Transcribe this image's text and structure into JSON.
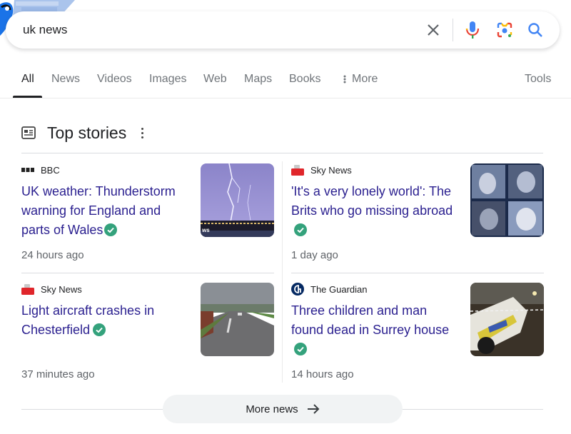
{
  "search": {
    "query": "uk news",
    "icons": [
      "clear-icon",
      "voice-search-icon",
      "lens-icon",
      "search-icon"
    ]
  },
  "tabs": [
    {
      "label": "All",
      "active": true
    },
    {
      "label": "News"
    },
    {
      "label": "Videos"
    },
    {
      "label": "Images"
    },
    {
      "label": "Web"
    },
    {
      "label": "Maps"
    },
    {
      "label": "Books"
    },
    {
      "label": "More",
      "icon": "kebab-icon"
    }
  ],
  "tools_label": "Tools",
  "top_stories": {
    "title": "Top stories",
    "icon": "newspaper-icon",
    "stories": [
      {
        "source": "BBC",
        "headline": "UK weather: Thunderstorm warning for England and parts of Wales",
        "time": "24 hours ago",
        "verified": true,
        "thumb": "lightning storm over town at night"
      },
      {
        "source": "Sky News",
        "headline": "'It's a very lonely world': The Brits who go missing abroad",
        "time": "1 day ago",
        "verified": true,
        "thumb": "collage of four faces"
      },
      {
        "source": "Sky News",
        "headline": "Light aircraft crashes in Chesterfield",
        "time": "37 minutes ago",
        "verified": true,
        "thumb": "road street view"
      },
      {
        "source": "The Guardian",
        "headline": "Three children and man found dead in Surrey house",
        "time": "14 hours ago",
        "verified": true,
        "thumb": "police car at night"
      }
    ]
  },
  "more_news": {
    "label": "More news",
    "icon": "arrow-right-icon"
  },
  "colors": {
    "link": "#2a1f8f",
    "verified": "#34a27c",
    "muted": "#5f6368"
  }
}
